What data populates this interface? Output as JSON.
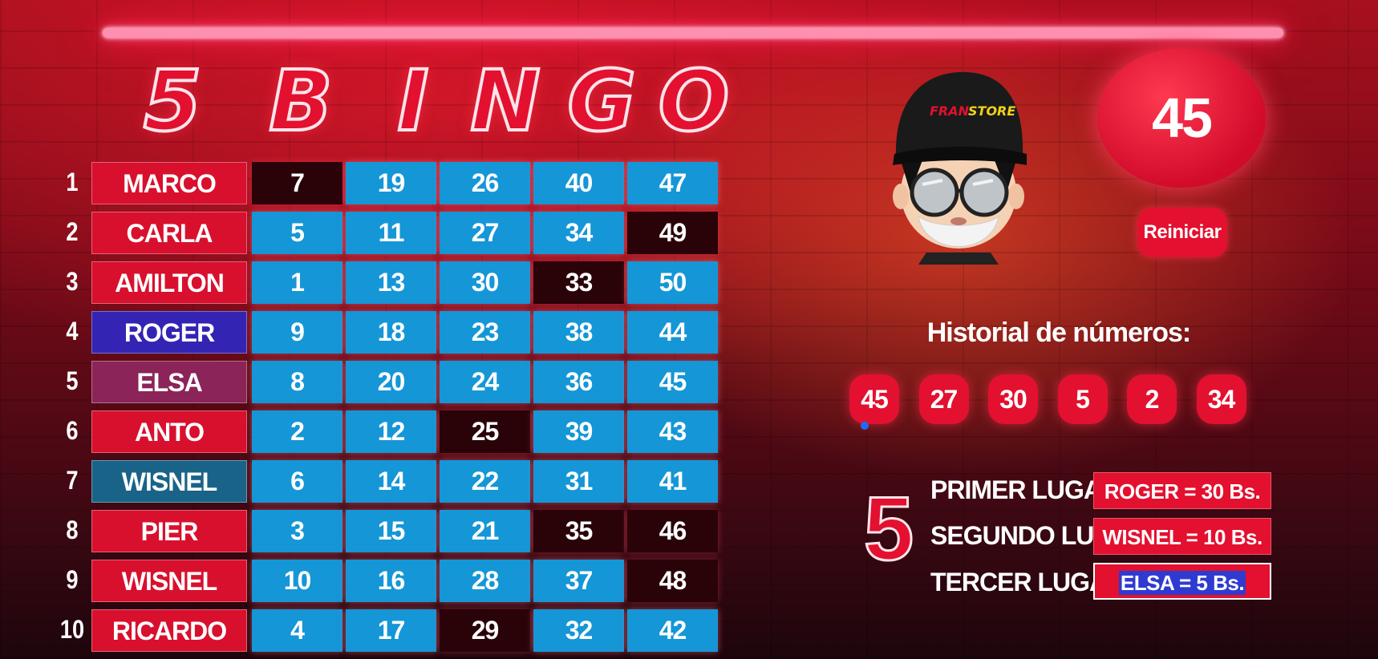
{
  "title_letters": [
    "5",
    "B",
    "I",
    "N",
    "G",
    "O"
  ],
  "players": [
    {
      "num": "1",
      "name": "MARCO",
      "color": "#d8102e",
      "numbers": [
        "7",
        "19",
        "26",
        "40",
        "47"
      ],
      "marked": [
        true,
        false,
        false,
        false,
        false
      ]
    },
    {
      "num": "2",
      "name": "CARLA",
      "color": "#d8102e",
      "numbers": [
        "5",
        "11",
        "27",
        "34",
        "49"
      ],
      "marked": [
        false,
        false,
        false,
        false,
        true
      ]
    },
    {
      "num": "3",
      "name": "AMILTON",
      "color": "#d8102e",
      "numbers": [
        "1",
        "13",
        "30",
        "33",
        "50"
      ],
      "marked": [
        false,
        false,
        false,
        true,
        false
      ]
    },
    {
      "num": "4",
      "name": "ROGER",
      "color": "#3424b4",
      "numbers": [
        "9",
        "18",
        "23",
        "38",
        "44"
      ],
      "marked": [
        false,
        false,
        false,
        false,
        false
      ]
    },
    {
      "num": "5",
      "name": "ELSA",
      "color": "#8b2458",
      "numbers": [
        "8",
        "20",
        "24",
        "36",
        "45"
      ],
      "marked": [
        false,
        false,
        false,
        false,
        false
      ]
    },
    {
      "num": "6",
      "name": "ANTO",
      "color": "#d8102e",
      "numbers": [
        "2",
        "12",
        "25",
        "39",
        "43"
      ],
      "marked": [
        false,
        false,
        true,
        false,
        false
      ]
    },
    {
      "num": "7",
      "name": "WISNEL",
      "color": "#1a6388",
      "numbers": [
        "6",
        "14",
        "22",
        "31",
        "41"
      ],
      "marked": [
        false,
        false,
        false,
        false,
        false
      ]
    },
    {
      "num": "8",
      "name": "PIER",
      "color": "#d8102e",
      "numbers": [
        "3",
        "15",
        "21",
        "35",
        "46"
      ],
      "marked": [
        false,
        false,
        false,
        true,
        true
      ]
    },
    {
      "num": "9",
      "name": "WISNEL",
      "color": "#d8102e",
      "numbers": [
        "10",
        "16",
        "28",
        "37",
        "48"
      ],
      "marked": [
        false,
        false,
        false,
        false,
        true
      ]
    },
    {
      "num": "10",
      "name": "RICARDO",
      "color": "#d8102e",
      "numbers": [
        "4",
        "17",
        "29",
        "32",
        "42"
      ],
      "marked": [
        false,
        false,
        true,
        false,
        false
      ]
    }
  ],
  "avatar": {
    "cap_text_1": "FRAN",
    "cap_text_2": "STORE"
  },
  "current_number": "45",
  "reset_label": "Reiniciar",
  "history_title": "Historial de números:",
  "history": [
    "45",
    "27",
    "30",
    "5",
    "2",
    "34"
  ],
  "big_number": "5",
  "places": [
    {
      "label": "PRIMER LUGAR",
      "value": "ROGER = 30 Bs."
    },
    {
      "label": "SEGUNDO LUGAR",
      "value": "WISNEL = 10 Bs."
    },
    {
      "label": "TERCER LUGAR",
      "value": "ELSA  = 5 Bs."
    }
  ],
  "colors": {
    "accent_red": "#e3102f",
    "cell_blue": "#1596d7",
    "marked_cell": "#2a0309"
  }
}
